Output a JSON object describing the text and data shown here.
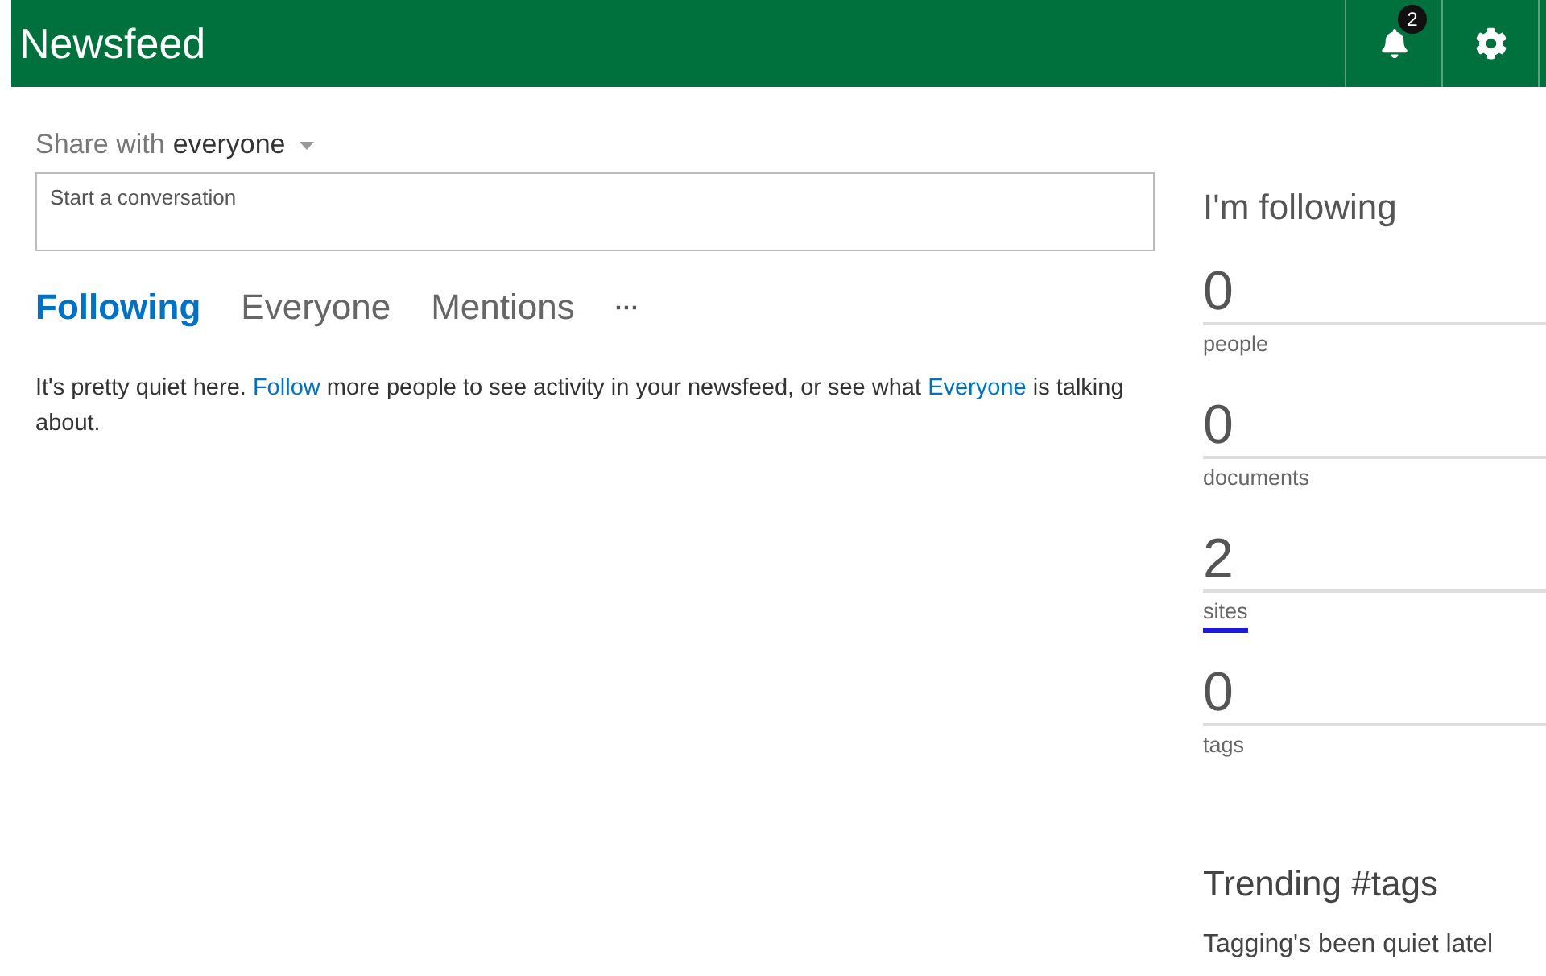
{
  "header": {
    "title": "Newsfeed",
    "notifications": "2"
  },
  "share": {
    "label": "Share with",
    "audience": "everyone"
  },
  "composer": {
    "placeholder": "Start a conversation"
  },
  "tabs": [
    {
      "label": "Following",
      "selected": true
    },
    {
      "label": "Everyone",
      "selected": false
    },
    {
      "label": "Mentions",
      "selected": false
    }
  ],
  "more": "···",
  "message": [
    {
      "kind": "text",
      "text": "It's pretty quiet here. "
    },
    {
      "kind": "link",
      "text": "Follow"
    },
    {
      "kind": "text",
      "text": " more people to see activity in your newsfeed, or see what "
    },
    {
      "kind": "link",
      "text": "Everyone"
    },
    {
      "kind": "text",
      "text": " is talking about."
    }
  ],
  "following": {
    "title": "I'm following",
    "stats": [
      {
        "count": "0",
        "label": "people",
        "selected": false
      },
      {
        "count": "0",
        "label": "documents",
        "selected": false
      },
      {
        "count": "2",
        "label": "sites",
        "selected": true
      },
      {
        "count": "0",
        "label": "tags",
        "selected": false
      }
    ]
  },
  "trending": {
    "title": "Trending #tags",
    "text": "Tagging's been quiet latel"
  }
}
